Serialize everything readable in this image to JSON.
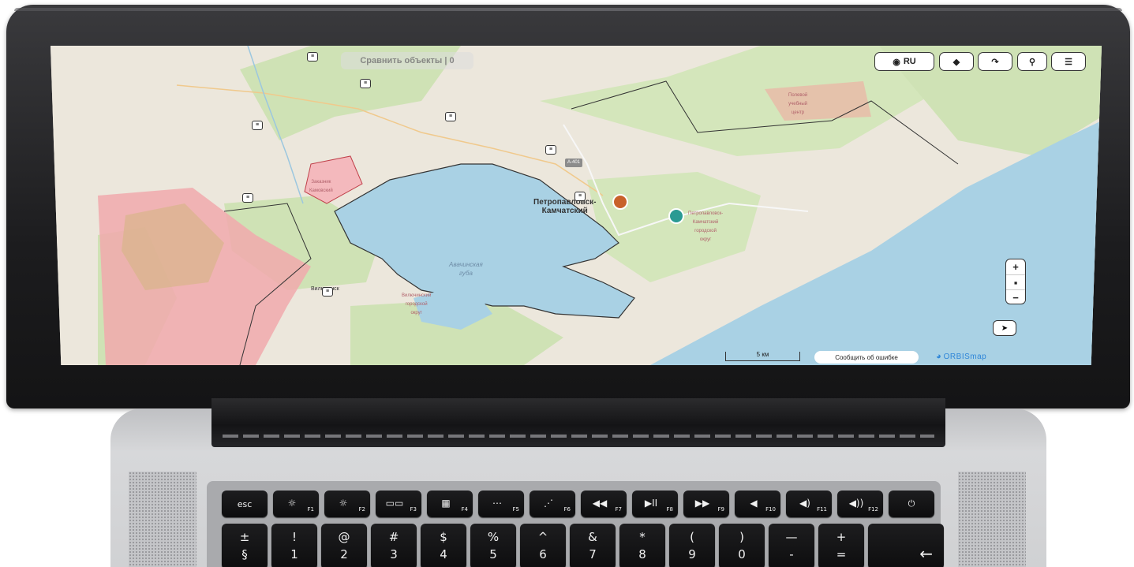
{
  "map": {
    "compare_label": "Сравнить объекты | 0",
    "language_label": "RU",
    "icons": {
      "language": "globe-icon",
      "layers": "layers-icon",
      "route": "route-icon",
      "search": "search-icon",
      "menu": "menu-icon",
      "locate": "locate-arrow-icon"
    },
    "zoom_in": "+",
    "zoom_out": "−",
    "scale_label": "5 км",
    "report_error_label": "Сообщить об ошибке",
    "logo_text": "ORBISmap",
    "labels": {
      "city": "Петропавловск-\nКамчатский",
      "bay": "Авачинская\nгубa",
      "road": "A-401",
      "reserve": "Заказник\nКамовский",
      "district": "Петропавловск-\nКамчатский\nгородской\nокруг",
      "field_center": "Полевой\nучебный\nцентр",
      "town": "Вилючинск",
      "vil_district": "Вилючинский\nгородской\nокруг"
    },
    "colors": {
      "water": "#a9d1e4",
      "forest": "#cfe2b5",
      "land": "#ece7dc",
      "reserve": "#f1a9ad",
      "marker_orange": "#c8612a",
      "marker_teal": "#2a9a93",
      "accent": "#2f86d8"
    }
  },
  "keyboard": {
    "function_row": [
      {
        "glyph": "esc",
        "fn": ""
      },
      {
        "glyph": "☼",
        "fn": "F1"
      },
      {
        "glyph": "☼",
        "fn": "F2"
      },
      {
        "glyph": "▭▭",
        "fn": "F3"
      },
      {
        "glyph": "▦",
        "fn": "F4"
      },
      {
        "glyph": "⋯",
        "fn": "F5"
      },
      {
        "glyph": "⋰",
        "fn": "F6"
      },
      {
        "glyph": "◀◀",
        "fn": "F7"
      },
      {
        "glyph": "▶II",
        "fn": "F8"
      },
      {
        "glyph": "▶▶",
        "fn": "F9"
      },
      {
        "glyph": "◀",
        "fn": "F10"
      },
      {
        "glyph": "◀)",
        "fn": "F11"
      },
      {
        "glyph": "◀))",
        "fn": "F12"
      },
      {
        "glyph": "⏻",
        "fn": ""
      }
    ],
    "number_row": [
      {
        "top": "±",
        "bottom": "§"
      },
      {
        "top": "!",
        "bottom": "1"
      },
      {
        "top": "@",
        "bottom": "2"
      },
      {
        "top": "#",
        "bottom": "3"
      },
      {
        "top": "$",
        "bottom": "4"
      },
      {
        "top": "%",
        "bottom": "5"
      },
      {
        "top": "^",
        "bottom": "6"
      },
      {
        "top": "&",
        "bottom": "7"
      },
      {
        "top": "*",
        "bottom": "8"
      },
      {
        "top": "(",
        "bottom": "9"
      },
      {
        "top": ")",
        "bottom": "0"
      },
      {
        "top": "—",
        "bottom": "-"
      },
      {
        "top": "+",
        "bottom": "="
      },
      {
        "top": "",
        "bottom": "←"
      }
    ]
  }
}
